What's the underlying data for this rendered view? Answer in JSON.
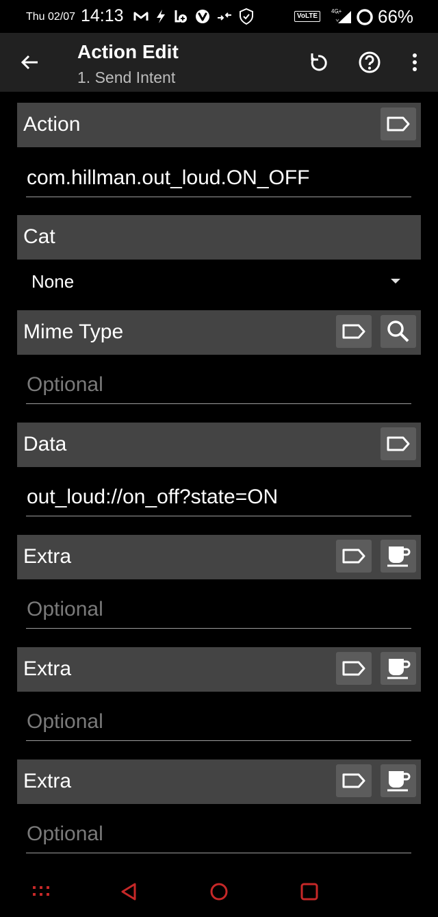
{
  "status_bar": {
    "date": "Thu 02/07",
    "time": "14:13",
    "volte_label": "VoLTE",
    "network_type": "4G+",
    "battery_percent": "66%",
    "battery_level": 0.66
  },
  "app_bar": {
    "title": "Action Edit",
    "subtitle": "1. Send Intent"
  },
  "action": {
    "label": "Action",
    "value": "com.hillman.out_loud.ON_OFF"
  },
  "cat": {
    "label": "Cat",
    "selected": "None"
  },
  "mime_type": {
    "label": "Mime Type",
    "value": "",
    "placeholder": "Optional"
  },
  "data": {
    "label": "Data",
    "value": "out_loud://on_off?state=ON"
  },
  "extras": [
    {
      "label": "Extra",
      "value": "",
      "placeholder": "Optional"
    },
    {
      "label": "Extra",
      "value": "",
      "placeholder": "Optional"
    },
    {
      "label": "Extra",
      "value": "",
      "placeholder": "Optional"
    }
  ],
  "colors": {
    "background": "#000000",
    "app_bar": "#212121",
    "section_header": "#444444",
    "header_button": "#5c5c5c",
    "nav_accent": "#c62828"
  }
}
